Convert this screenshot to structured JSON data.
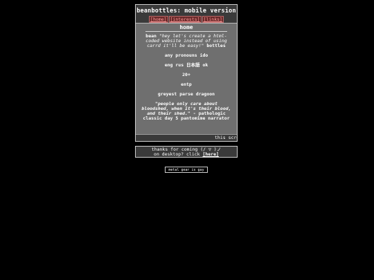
{
  "header": {
    "title": "beanbottles: mobile version"
  },
  "nav": [
    {
      "label": "[home]"
    },
    {
      "label": "[interests]"
    },
    {
      "label": "[links]"
    }
  ],
  "page": {
    "title": "home"
  },
  "bio": {
    "name": "bean",
    "quote": "\"hey let's create a html-coded website instead of using carrd it'll be easy!\"",
    "quote_suffix": "bottles",
    "lines": [
      "any pronouns ido",
      "eng rus 日本語 ok",
      "20+",
      "entp",
      "greyest parse dragoon"
    ],
    "citation_quote": "\"people only care about bloodshed, when it's their blood, and their shed.\"",
    "citation_source": "- pathologic classic day 5 pantomime narrator"
  },
  "marquee": {
    "text": "this scrolls"
  },
  "footer": {
    "line1": "thanks for coming (/ ▽ )ノ",
    "line2_prefix": "on desktop? click",
    "link_label": "[here]"
  },
  "badge": {
    "text": "metal gear is gay"
  }
}
